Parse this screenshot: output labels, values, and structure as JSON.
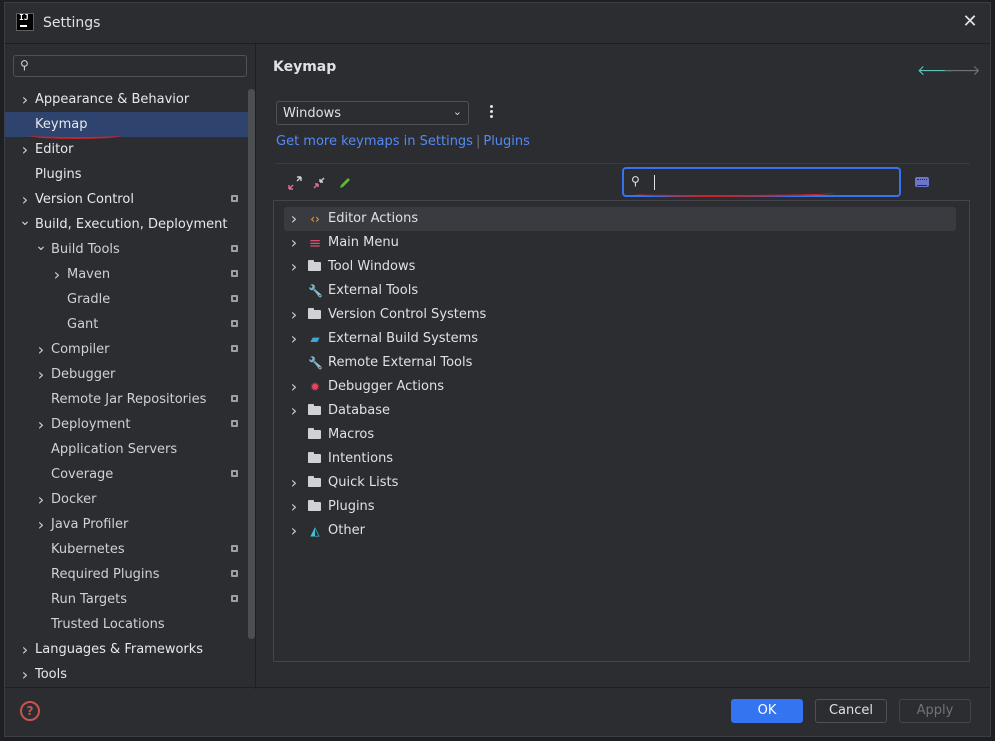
{
  "window": {
    "title": "Settings",
    "app_icon_text": "IJ"
  },
  "sidebar": {
    "search_placeholder": "",
    "items": [
      {
        "label": "Appearance & Behavior",
        "chevron": "right",
        "level": 0,
        "bold": true,
        "lock": false,
        "selected": false
      },
      {
        "label": "Keymap",
        "chevron": "",
        "level": 0,
        "bold": true,
        "lock": false,
        "selected": true
      },
      {
        "label": "Editor",
        "chevron": "right",
        "level": 0,
        "bold": true,
        "lock": false,
        "selected": false
      },
      {
        "label": "Plugins",
        "chevron": "",
        "level": 0,
        "bold": true,
        "lock": false,
        "selected": false
      },
      {
        "label": "Version Control",
        "chevron": "right",
        "level": 0,
        "bold": true,
        "lock": true,
        "selected": false
      },
      {
        "label": "Build, Execution, Deployment",
        "chevron": "down",
        "level": 0,
        "bold": true,
        "lock": false,
        "selected": false
      },
      {
        "label": "Build Tools",
        "chevron": "down",
        "level": 1,
        "bold": false,
        "lock": true,
        "selected": false
      },
      {
        "label": "Maven",
        "chevron": "right",
        "level": 2,
        "bold": false,
        "lock": true,
        "selected": false
      },
      {
        "label": "Gradle",
        "chevron": "",
        "level": 2,
        "bold": false,
        "lock": true,
        "selected": false
      },
      {
        "label": "Gant",
        "chevron": "",
        "level": 2,
        "bold": false,
        "lock": true,
        "selected": false
      },
      {
        "label": "Compiler",
        "chevron": "right",
        "level": 1,
        "bold": false,
        "lock": true,
        "selected": false
      },
      {
        "label": "Debugger",
        "chevron": "right",
        "level": 1,
        "bold": false,
        "lock": false,
        "selected": false
      },
      {
        "label": "Remote Jar Repositories",
        "chevron": "",
        "level": 1,
        "bold": false,
        "lock": true,
        "selected": false
      },
      {
        "label": "Deployment",
        "chevron": "right",
        "level": 1,
        "bold": false,
        "lock": true,
        "selected": false
      },
      {
        "label": "Application Servers",
        "chevron": "",
        "level": 1,
        "bold": false,
        "lock": false,
        "selected": false
      },
      {
        "label": "Coverage",
        "chevron": "",
        "level": 1,
        "bold": false,
        "lock": true,
        "selected": false
      },
      {
        "label": "Docker",
        "chevron": "right",
        "level": 1,
        "bold": false,
        "lock": false,
        "selected": false
      },
      {
        "label": "Java Profiler",
        "chevron": "right",
        "level": 1,
        "bold": false,
        "lock": false,
        "selected": false
      },
      {
        "label": "Kubernetes",
        "chevron": "",
        "level": 1,
        "bold": false,
        "lock": true,
        "selected": false
      },
      {
        "label": "Required Plugins",
        "chevron": "",
        "level": 1,
        "bold": false,
        "lock": true,
        "selected": false
      },
      {
        "label": "Run Targets",
        "chevron": "",
        "level": 1,
        "bold": false,
        "lock": true,
        "selected": false
      },
      {
        "label": "Trusted Locations",
        "chevron": "",
        "level": 1,
        "bold": false,
        "lock": false,
        "selected": false
      },
      {
        "label": "Languages & Frameworks",
        "chevron": "right",
        "level": 0,
        "bold": true,
        "lock": false,
        "selected": false
      },
      {
        "label": "Tools",
        "chevron": "right",
        "level": 0,
        "bold": true,
        "lock": false,
        "selected": false
      }
    ]
  },
  "main": {
    "title": "Keymap",
    "keymap_select": {
      "value": "Windows"
    },
    "links": {
      "get_more": "Get more keymaps in Settings",
      "separator": "|",
      "plugins": "Plugins"
    },
    "search": {
      "value": "",
      "placeholder": ""
    },
    "toolbar_icons": [
      "expand-all-icon",
      "collapse-all-icon",
      "edit-icon"
    ],
    "actions": [
      {
        "label": "Editor Actions",
        "chevron": true,
        "icon": "code-brackets-icon",
        "icon_type": "code",
        "selected": true
      },
      {
        "label": "Main Menu",
        "chevron": true,
        "icon": "menu-lines-icon",
        "icon_type": "menu",
        "selected": false
      },
      {
        "label": "Tool Windows",
        "chevron": true,
        "icon": "folder-icon",
        "icon_type": "folder",
        "selected": false
      },
      {
        "label": "External Tools",
        "chevron": false,
        "icon": "wrench-icon",
        "icon_type": "wrench",
        "selected": false
      },
      {
        "label": "Version Control Systems",
        "chevron": true,
        "icon": "folder-icon",
        "icon_type": "folder",
        "selected": false
      },
      {
        "label": "External Build Systems",
        "chevron": true,
        "icon": "build-folder-icon",
        "icon_type": "buildfolder",
        "selected": false
      },
      {
        "label": "Remote External Tools",
        "chevron": false,
        "icon": "wrench-icon",
        "icon_type": "wrench",
        "selected": false
      },
      {
        "label": "Debugger Actions",
        "chevron": true,
        "icon": "bug-icon",
        "icon_type": "bug",
        "selected": false
      },
      {
        "label": "Database",
        "chevron": true,
        "icon": "folder-icon",
        "icon_type": "folder",
        "selected": false
      },
      {
        "label": "Macros",
        "chevron": false,
        "icon": "folder-icon",
        "icon_type": "folder",
        "selected": false
      },
      {
        "label": "Intentions",
        "chevron": false,
        "icon": "folder-icon",
        "icon_type": "folder",
        "selected": false
      },
      {
        "label": "Quick Lists",
        "chevron": true,
        "icon": "folder-icon",
        "icon_type": "folder",
        "selected": false
      },
      {
        "label": "Plugins",
        "chevron": true,
        "icon": "folder-icon",
        "icon_type": "folder",
        "selected": false
      },
      {
        "label": "Other",
        "chevron": true,
        "icon": "basket-icon",
        "icon_type": "basket",
        "selected": false
      }
    ]
  },
  "footer": {
    "ok": "OK",
    "cancel": "Cancel",
    "apply": "Apply",
    "help": "?"
  },
  "colors": {
    "accent": "#3574f0",
    "link": "#548af7",
    "selection": "#2e436e",
    "annotation": "#c1272d"
  }
}
